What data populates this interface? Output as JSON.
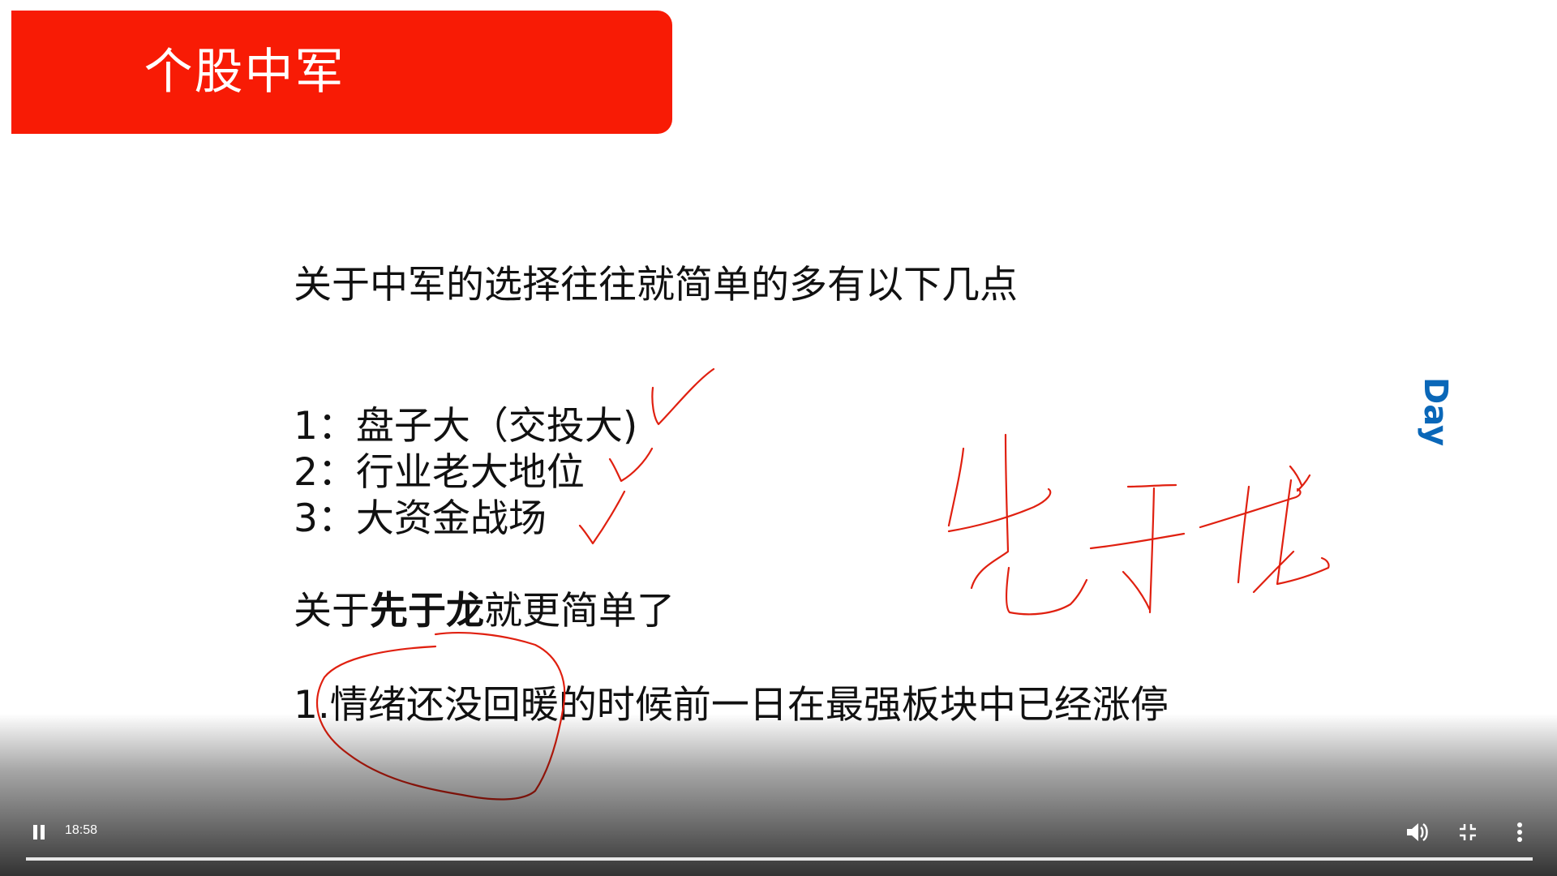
{
  "slide": {
    "title": "个股中军",
    "line1": "关于中军的选择往往就简单的多有以下几点",
    "item1": "1：盘子大（交投大)",
    "item2": "2：行业老大地位",
    "item3": "3：大资金战场",
    "line5_prefix": "关于",
    "line5_bold": "先于龙",
    "line5_suffix": "就更简单了",
    "line6": "1.情绪还没回暖的时候前一日在最强板块中已经涨停",
    "side_label": "Day",
    "handwriting": "先于龙"
  },
  "player": {
    "time": "18:58",
    "progress": 1.0,
    "pause_icon": "pause-icon",
    "volume_icon": "volume-icon",
    "exit_fullscreen_icon": "exit-fullscreen-icon",
    "more_icon": "more-vertical-icon"
  },
  "colors": {
    "banner": "#f81b05",
    "ink": "#e02010",
    "day_label": "#0a67b8"
  }
}
